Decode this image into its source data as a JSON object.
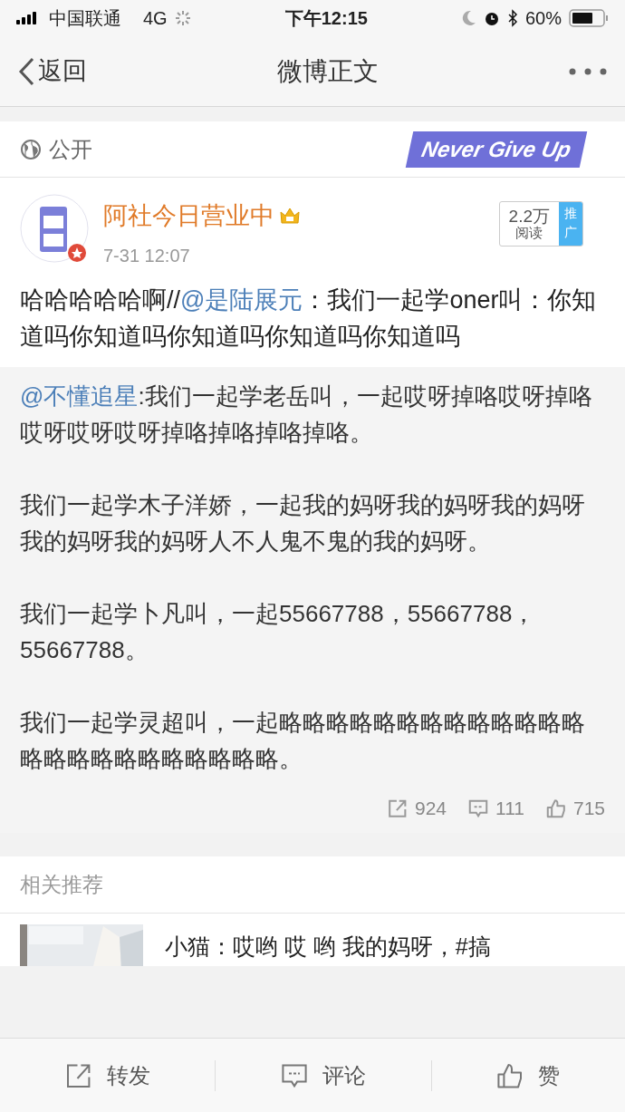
{
  "status_bar": {
    "carrier": "中国联通",
    "network": "4G",
    "time": "下午12:15",
    "battery": "60%"
  },
  "nav": {
    "back": "返回",
    "title": "微博正文"
  },
  "visibility": {
    "label": "公开",
    "banner": "Never Give Up"
  },
  "post": {
    "author": "阿社今日营业中",
    "time": "7-31 12:07",
    "reads": "2.2万",
    "reads_label": "阅读",
    "promote": "推广",
    "text": [
      {
        "kind": "plain",
        "text": "哈哈哈哈哈啊//"
      },
      {
        "kind": "mention",
        "text": "@是陆展元"
      },
      {
        "kind": "plain",
        "text": "：我们一起学oner叫：你知道吗你知道吗你知道吗你知道吗你知道吗"
      }
    ]
  },
  "retweet": {
    "paragraphs": [
      [
        {
          "kind": "mention",
          "text": "@不懂追星"
        },
        {
          "kind": "plain",
          "text": ":我们一起学老岳叫，一起哎呀掉咯哎呀掉咯哎呀哎呀哎呀掉咯掉咯掉咯掉咯。"
        }
      ],
      [
        {
          "kind": "plain",
          "text": "我们一起学木子洋娇，一起我的妈呀我的妈呀我的妈呀我的妈呀我的妈呀人不人鬼不鬼的我的妈呀。"
        }
      ],
      [
        {
          "kind": "plain",
          "text": "我们一起学卜凡叫，一起55667788，55667788，55667788。"
        }
      ],
      [
        {
          "kind": "plain",
          "text": "我们一起学灵超叫，一起略略略略略略略略略略略略略略略略略略略略略略略略。"
        }
      ]
    ],
    "stats": [
      {
        "kind": "repost",
        "count": "924"
      },
      {
        "kind": "comment",
        "count": "111"
      },
      {
        "kind": "like",
        "count": "715"
      }
    ]
  },
  "related": {
    "title": "相关推荐",
    "items": [
      {
        "text": "小猫：哎哟 哎 哟 我的妈呀，#搞"
      }
    ]
  },
  "toolbar": [
    {
      "kind": "repost",
      "label": "转发"
    },
    {
      "kind": "comment",
      "label": "评论"
    },
    {
      "kind": "like",
      "label": "赞"
    }
  ]
}
